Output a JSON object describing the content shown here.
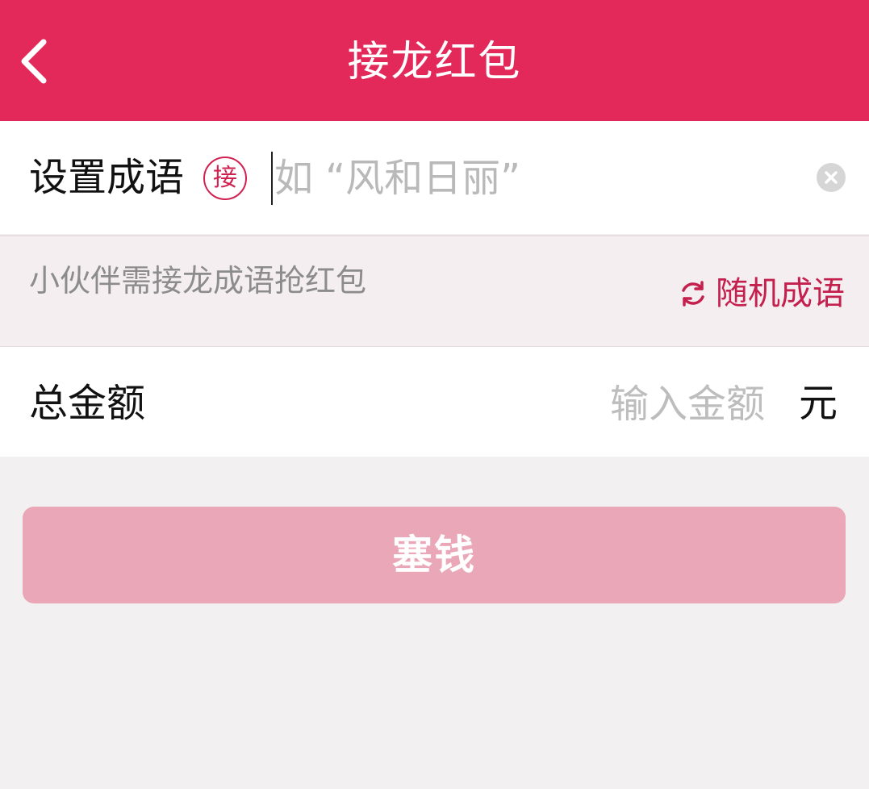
{
  "header": {
    "title": "接龙红包",
    "back_icon": "chevron-left-icon",
    "background_color": "#e3285a"
  },
  "idiom": {
    "label": "设置成语",
    "badge": "接",
    "placeholder": "如 “风和日丽”",
    "value": "",
    "clear_icon": "clear-icon"
  },
  "hint": {
    "text": "小伙伴需接龙成语抢红包",
    "random_label": "随机成语",
    "random_icon": "refresh-icon",
    "accent_color": "#c4204e"
  },
  "amount": {
    "label": "总金额",
    "placeholder": "输入金额",
    "value": "",
    "unit": "元"
  },
  "submit": {
    "label": "塞钱",
    "color": "#eaa7b7"
  }
}
